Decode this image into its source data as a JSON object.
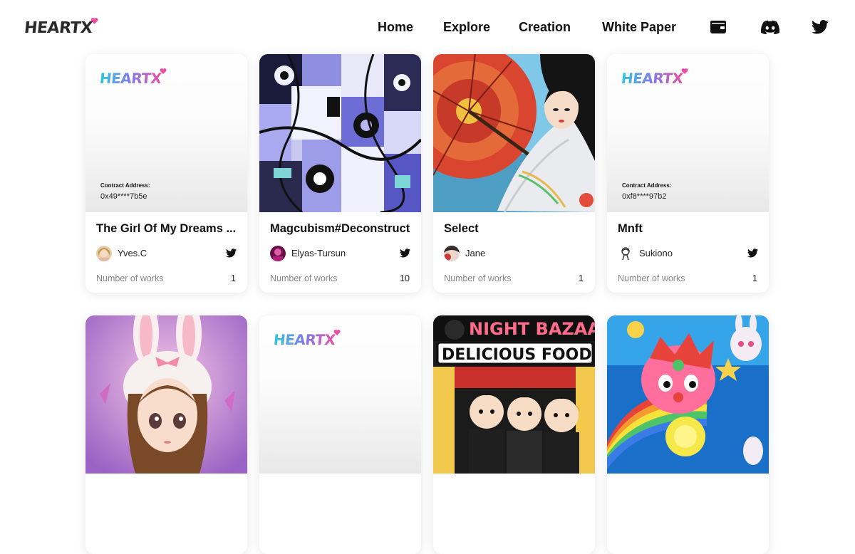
{
  "header": {
    "logo_text": "HEARTX",
    "nav": {
      "home": "Home",
      "explore": "Explore",
      "creation": "Creation",
      "white_paper": "White Paper"
    },
    "icons": [
      "wallet-icon",
      "discord-icon",
      "twitter-icon"
    ]
  },
  "placeholder_logo": "HEARTX",
  "cards": [
    {
      "title": "The Girl Of My Dreams ...",
      "creator": "Yves.C",
      "works_label": "Number of works",
      "works_count": "1",
      "contract_label": "Contract Address:",
      "contract_address": "0x49****7b5e"
    },
    {
      "title": "Magcubism#Deconstruct",
      "creator": "Elyas-Tursun",
      "works_label": "Number of works",
      "works_count": "10"
    },
    {
      "title": "Select",
      "creator": "Jane",
      "works_label": "Number of works",
      "works_count": "1"
    },
    {
      "title": "Mnft",
      "creator": "Sukiono",
      "works_label": "Number of works",
      "works_count": "1",
      "contract_label": "Contract Address:",
      "contract_address": "0xf8****97b2"
    }
  ],
  "bottom_art": {
    "card7_line1": "NIGHT BAZAAR",
    "card7_line2": "DELICIOUS FOOD"
  },
  "colors": {
    "brand_cyan": "#2ec9e0",
    "brand_pink": "#ea4fa6",
    "text_dark": "#111111",
    "muted": "#888888"
  }
}
